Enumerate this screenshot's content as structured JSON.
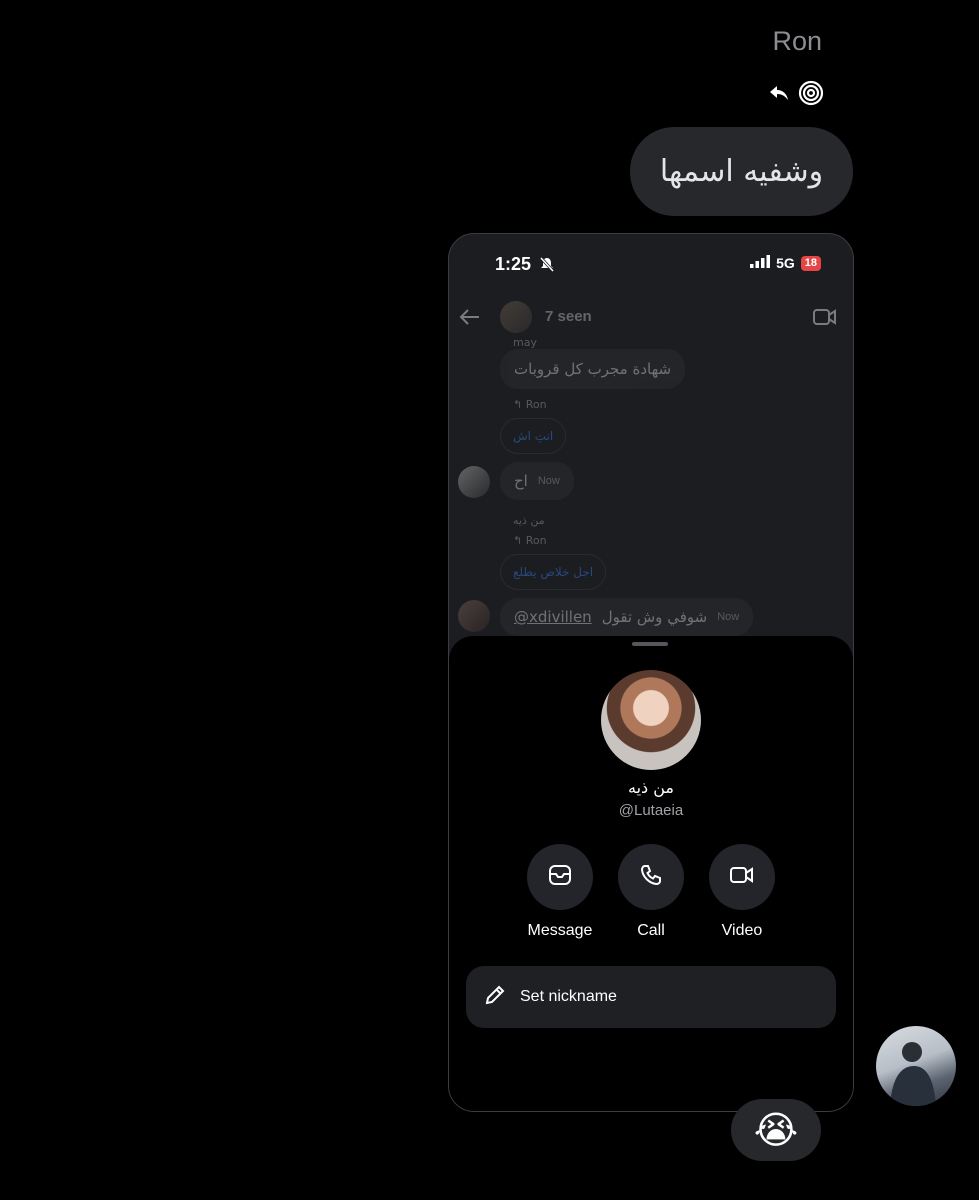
{
  "thread": {
    "sender_name": "Ron",
    "reply_icon": "reply-arrow-icon",
    "vanish_icon": "spiral-icon",
    "message": "وشفيه اسمها",
    "reaction_emoji": "😭"
  },
  "screenshot": {
    "status_bar": {
      "time": "1:25",
      "network": "5G",
      "battery": "18"
    },
    "header": {
      "seen_text": "7 seen"
    },
    "messages": [
      {
        "prefix": "may",
        "text": "شهادة مجرب كل قروبات"
      },
      {
        "reply_to": "Ron",
        "text": "انتِ اش"
      },
      {
        "text": "اح",
        "time": "Now"
      },
      {
        "sender": "من ذيه",
        "reply_to": "Ron",
        "text": "اجل خلاص يطلع"
      },
      {
        "mention": "@xdivillen",
        "text": "شوفي وش تقول",
        "time": "Now"
      }
    ],
    "profile": {
      "name": "من ذيه",
      "handle": "@Lutaeia",
      "actions": [
        {
          "label": "Message",
          "icon": "message-icon"
        },
        {
          "label": "Call",
          "icon": "phone-icon"
        },
        {
          "label": "Video",
          "icon": "video-icon"
        }
      ],
      "nickname_label": "Set nickname"
    }
  }
}
